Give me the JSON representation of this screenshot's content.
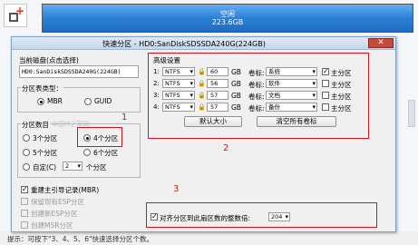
{
  "background": {
    "disk_label": "空闲",
    "disk_size": "223.6GB",
    "footer_tip": "提示：可按下\"3、4、5、6\"快速选择分区个数。"
  },
  "dialog": {
    "title": "快速分区 - HD0:SanDiskSDSSDA240G(224GB)",
    "close_symbol": "✕"
  },
  "left": {
    "current_disk_label": "当前磁盘(点击选择)",
    "current_disk_value": "HD0:SanDiskSDSSDA240G(224GB)",
    "partition_type_label": "分区表类型：",
    "partition_types": [
      "MBR",
      "GUID"
    ],
    "partition_type_selected": "MBR",
    "partition_count_label": "分区数目",
    "counts": [
      "3个分区",
      "4个分区",
      "5个分区",
      "6个分区",
      "自定(C)"
    ],
    "count_selected": "4个分区",
    "custom_value": "2",
    "custom_unit": "个分区",
    "watermark": "中国IT之家网",
    "rebuild_mbr_label": "重建主引导记录(MBR)",
    "rebuild_mbr_checked": true,
    "keep_esp_label": "保留现有ESP分区",
    "new_esp_label": "创建新ESP分区",
    "new_msr_label": "创建MSR分区"
  },
  "advanced": {
    "title": "高级设置",
    "size_unit": "GB",
    "volume_label_caption": "卷标:",
    "primary_caption": "主分区",
    "rows": [
      {
        "num": "1:",
        "fs": "NTFS",
        "size": "60",
        "label": "系统",
        "primary": true
      },
      {
        "num": "2:",
        "fs": "NTFS",
        "size": "56",
        "label": "软件",
        "primary": false
      },
      {
        "num": "3:",
        "fs": "NTFS",
        "size": "57",
        "label": "文档",
        "primary": false
      },
      {
        "num": "4:",
        "fs": "NTFS",
        "size": "57",
        "label": "备份",
        "primary": false
      }
    ],
    "default_size_button": "默认大小",
    "clear_labels_button": "清空所有卷标"
  },
  "align": {
    "label": "对齐分区到此扇区数的整数倍:",
    "checked": true,
    "value": "204"
  },
  "annotations": {
    "num1": "1",
    "num2": "2",
    "num3": "3",
    "color": "#d8121a"
  }
}
